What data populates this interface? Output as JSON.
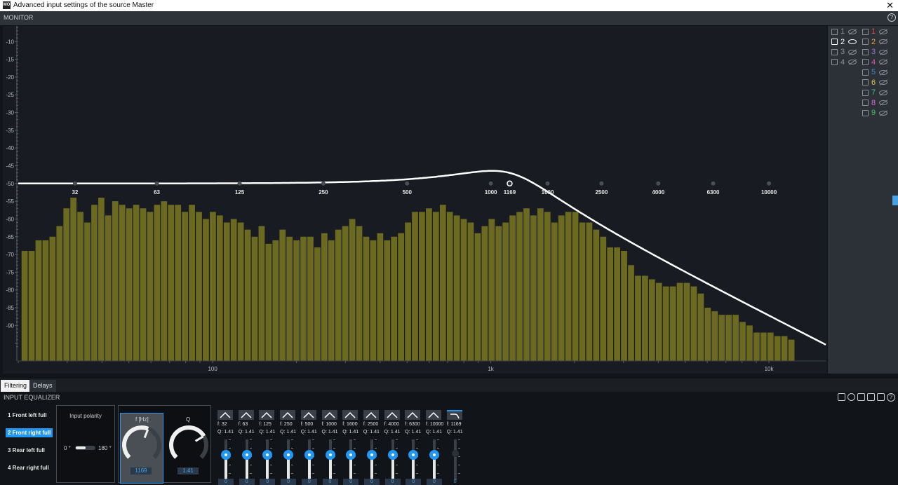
{
  "window": {
    "title": "Advanced input settings of the source Master",
    "logo": "MO",
    "close_glyph": "✕"
  },
  "monitor": {
    "label": "MONITOR",
    "help": "?"
  },
  "chart_data": {
    "type": "bar",
    "xscale": "log",
    "xlim": [
      20,
      16000
    ],
    "ylim": [
      -100,
      -6
    ],
    "y_ticks": [
      -10,
      -15,
      -20,
      -25,
      -30,
      -35,
      -40,
      -45,
      -50,
      -55,
      -60,
      -65,
      -70,
      -75,
      -80,
      -85,
      -90
    ],
    "x_ticks": [
      {
        "v": 100,
        "label": "100"
      },
      {
        "v": 1000,
        "label": "1k"
      },
      {
        "v": 10000,
        "label": "10k"
      }
    ],
    "bar_color": "#6b6a20",
    "curve_color": "#ffffff",
    "spectrum_start_hz": 20.5,
    "spectrum_step_ratio": 1.0594,
    "spectrum_db": [
      -69,
      -69,
      -66,
      -66,
      -65,
      -62,
      -57,
      -54,
      -58,
      -61,
      -56,
      -54,
      -59,
      -55,
      -56,
      -57,
      -56,
      -57,
      -58,
      -56,
      -55,
      -56,
      -56,
      -58,
      -56,
      -58,
      -60,
      -58,
      -59,
      -61,
      -60,
      -61,
      -63,
      -65,
      -62,
      -67,
      -66,
      -63,
      -65,
      -66,
      -65,
      -65,
      -68,
      -64,
      -66,
      -63,
      -62,
      -60,
      -62,
      -65,
      -66,
      -64,
      -66,
      -65,
      -64,
      -61,
      -58,
      -58,
      -57,
      -58,
      -56,
      -58,
      -59,
      -60,
      -61,
      -64,
      -62,
      -60,
      -62,
      -61,
      -59,
      -58,
      -57,
      -59,
      -57,
      -58,
      -61,
      -59,
      -58,
      -58,
      -61,
      -61,
      -63,
      -65,
      -68,
      -68,
      -69,
      -73,
      -76,
      -76,
      -77,
      -78,
      -79,
      -79,
      -78,
      -78,
      -79,
      -81,
      -85,
      -86,
      -87,
      -87,
      -87,
      -89,
      -90,
      -92,
      -92,
      -92,
      -93,
      -93,
      -94
    ],
    "eq_points": [
      {
        "f": 32,
        "label": "32",
        "selected": false
      },
      {
        "f": 63,
        "label": "63",
        "selected": false
      },
      {
        "f": 125,
        "label": "125",
        "selected": false
      },
      {
        "f": 250,
        "label": "250",
        "selected": false
      },
      {
        "f": 500,
        "label": "500",
        "selected": false
      },
      {
        "f": 1000,
        "label": "1000",
        "selected": false
      },
      {
        "f": 1169,
        "label": "1169",
        "selected": true
      },
      {
        "f": 1600,
        "label": "1600",
        "selected": false
      },
      {
        "f": 2500,
        "label": "2500",
        "selected": false
      },
      {
        "f": 4000,
        "label": "4000",
        "selected": false
      },
      {
        "f": 6300,
        "label": "6300",
        "selected": false
      },
      {
        "f": 10000,
        "label": "10000",
        "selected": false
      }
    ],
    "eq_curve": {
      "base_db": -50,
      "lowpass_hz": 1169,
      "q": 1.41
    }
  },
  "inputs": [
    {
      "label": "1",
      "visible": false
    },
    {
      "label": "2",
      "visible": true
    },
    {
      "label": "3",
      "visible": false
    },
    {
      "label": "4",
      "visible": false
    }
  ],
  "outputs": [
    {
      "label": "1",
      "color": "#e05050"
    },
    {
      "label": "2",
      "color": "#e0a040"
    },
    {
      "label": "3",
      "color": "#9a70d0"
    },
    {
      "label": "4",
      "color": "#e050a0"
    },
    {
      "label": "5",
      "color": "#3a8ad0"
    },
    {
      "label": "6",
      "color": "#e0c040"
    },
    {
      "label": "7",
      "color": "#40c0a0"
    },
    {
      "label": "8",
      "color": "#e060e0"
    },
    {
      "label": "9",
      "color": "#40c060"
    }
  ],
  "tabs": [
    {
      "label": "Filtering",
      "active": true
    },
    {
      "label": "Delays",
      "active": false
    }
  ],
  "equalizer": {
    "label": "INPUT EQUALIZER",
    "help": "?",
    "channels": [
      {
        "label": "1  Front left full",
        "selected": false
      },
      {
        "label": "2  Front right full",
        "selected": true
      },
      {
        "label": "3  Rear left full",
        "selected": false
      },
      {
        "label": "4  Rear right full",
        "selected": false
      }
    ],
    "polarity": {
      "title": "Input polarity",
      "left": "0 °",
      "right": "180 °"
    },
    "knobs": {
      "freq": {
        "label": "f [Hz]",
        "value": "1169",
        "fraction": 0.58
      },
      "q": {
        "label": "Q",
        "value": "1.41",
        "fraction": 0.72
      }
    },
    "bands": [
      {
        "f": "f: 32",
        "q": "Q: 1.41",
        "gain": "0",
        "type": "peak"
      },
      {
        "f": "f: 63",
        "q": "Q: 1.41",
        "gain": "0",
        "type": "peak"
      },
      {
        "f": "f: 125",
        "q": "Q: 1.41",
        "gain": "0",
        "type": "peak"
      },
      {
        "f": "f: 250",
        "q": "Q: 1.41",
        "gain": "0",
        "type": "peak"
      },
      {
        "f": "f: 500",
        "q": "Q: 1.41",
        "gain": "0",
        "type": "peak"
      },
      {
        "f": "f: 1000",
        "q": "Q: 1.41",
        "gain": "0",
        "type": "peak"
      },
      {
        "f": "f: 1600",
        "q": "Q: 1.41",
        "gain": "0",
        "type": "peak"
      },
      {
        "f": "f: 2500",
        "q": "Q: 1.41",
        "gain": "0",
        "type": "peak"
      },
      {
        "f": "f: 4000",
        "q": "Q: 1.41",
        "gain": "0",
        "type": "peak"
      },
      {
        "f": "f: 6300",
        "q": "Q: 1.41",
        "gain": "0",
        "type": "peak"
      },
      {
        "f": "f: 10000",
        "q": "Q: 1.41",
        "gain": "0",
        "type": "peak"
      },
      {
        "f": "f: 1169",
        "q": "Q: 1.41",
        "gain": "0",
        "type": "lowpass"
      }
    ]
  }
}
